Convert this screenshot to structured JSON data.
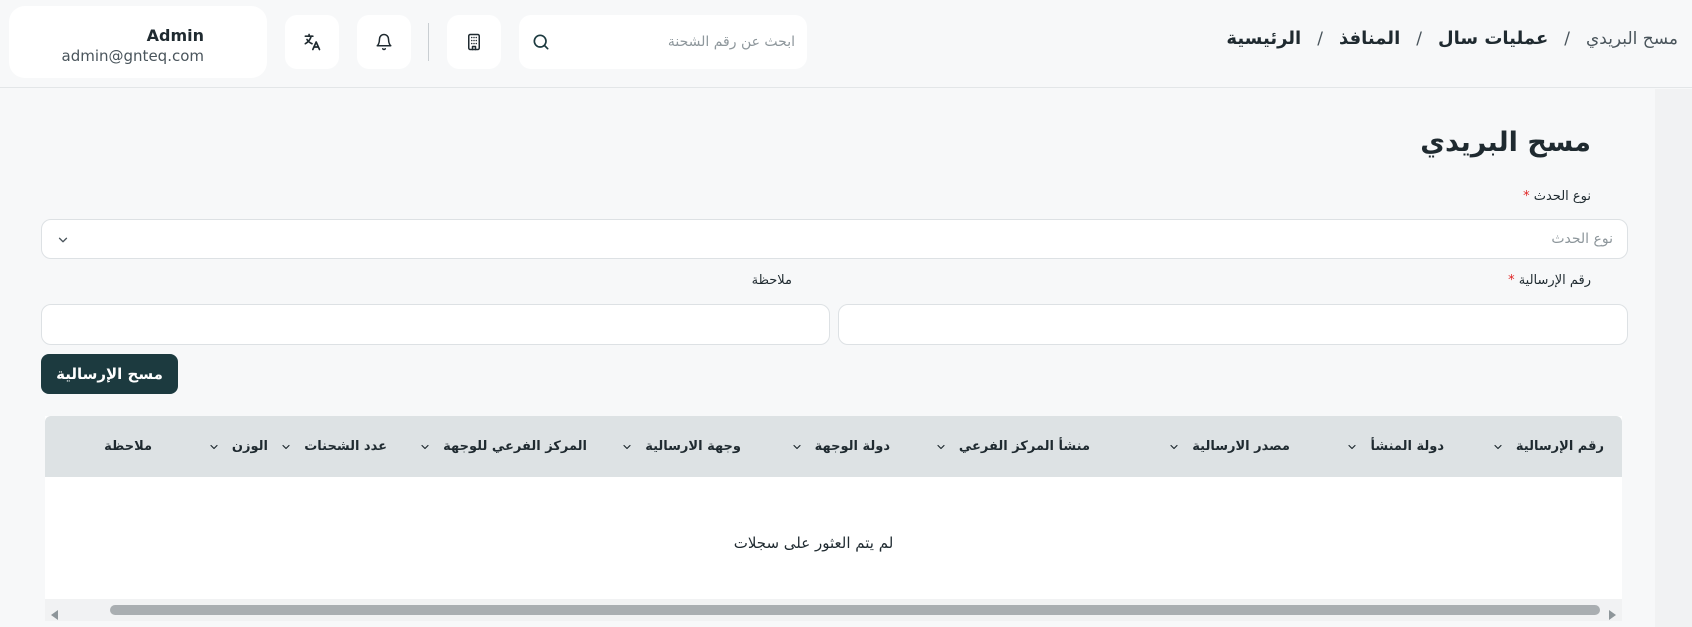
{
  "header": {
    "user": {
      "name": "Admin",
      "email": "admin@gnteq.com"
    },
    "search": {
      "placeholder": "ابحث عن رقم الشحنة",
      "value": ""
    },
    "icons": {
      "translate": "translate-icon",
      "notifications": "bell-icon",
      "building": "building-icon",
      "search": "search-icon"
    },
    "breadcrumb": [
      {
        "label": "الرئيسية"
      },
      {
        "label": "المنافذ"
      },
      {
        "label": "عمليات سال"
      },
      {
        "label": "مسح البريدي"
      }
    ],
    "breadcrumb_separator": "/"
  },
  "page": {
    "title": "مسح البريدي",
    "form": {
      "event_type": {
        "label": "نوع الحدث",
        "required_mark": "*",
        "placeholder": "نوع الحدث"
      },
      "shipment_number": {
        "label": "رقم الإرسالية",
        "required_mark": "*",
        "value": ""
      },
      "note": {
        "label": "ملاحظة",
        "value": ""
      },
      "submit_label": "مسح الإرسالية"
    },
    "table": {
      "columns": [
        "رقم الإرسالية",
        "دولة المنشأ",
        "مصدر الارسالية",
        "منشأ المركز الفرعي",
        "دولة الوجهة",
        "وجهة الارسالية",
        "المركز الفرعي للوجهة",
        "عدد الشحنات",
        "الوزن",
        "ملاحظة"
      ],
      "empty_message": "لم يتم العثور على سجلات"
    }
  },
  "colors": {
    "primary_button": "#1c3a3f",
    "required": "#e02424",
    "table_header": "#dde2e4",
    "background": "#f7f8f9"
  }
}
